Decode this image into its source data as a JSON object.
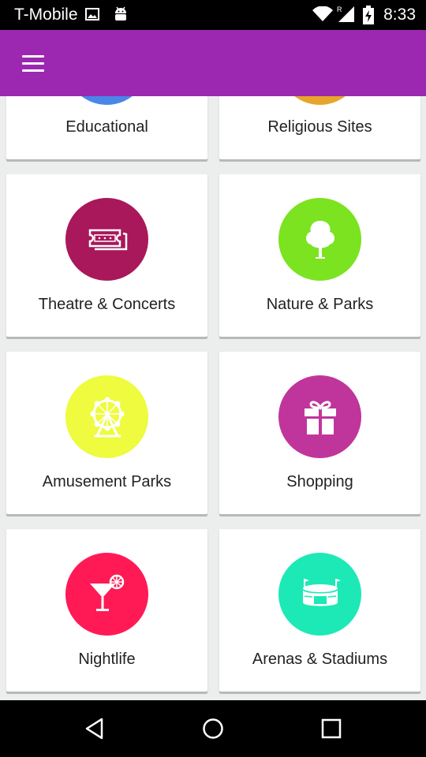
{
  "status_bar": {
    "carrier": "T-Mobile",
    "time": "8:33",
    "icons": [
      "image-icon",
      "android-icon",
      "wifi-icon",
      "signal-icon",
      "battery-charging-icon"
    ],
    "roaming_marker": "R"
  },
  "app_bar": {
    "color": "#9c27b0",
    "menu_icon": "hamburger-menu-icon"
  },
  "categories": [
    {
      "label": "Educational",
      "color": "#4a86e8",
      "icon": "education-icon"
    },
    {
      "label": "Religious Sites",
      "color": "#e8a52a",
      "icon": "religious-icon"
    },
    {
      "label": "Theatre & Concerts",
      "color": "#a8185a",
      "icon": "ticket-icon"
    },
    {
      "label": "Nature & Parks",
      "color": "#7be31f",
      "icon": "tree-icon"
    },
    {
      "label": "Amusement Parks",
      "color": "#eefb3e",
      "icon": "ferris-wheel-icon"
    },
    {
      "label": "Shopping",
      "color": "#c0359c",
      "icon": "gift-icon"
    },
    {
      "label": "Nightlife",
      "color": "#ff1a55",
      "icon": "cocktail-icon"
    },
    {
      "label": "Arenas & Stadiums",
      "color": "#1de9b6",
      "icon": "stadium-icon"
    }
  ],
  "nav_bar": {
    "buttons": [
      "back-icon",
      "home-icon",
      "recents-icon"
    ]
  }
}
